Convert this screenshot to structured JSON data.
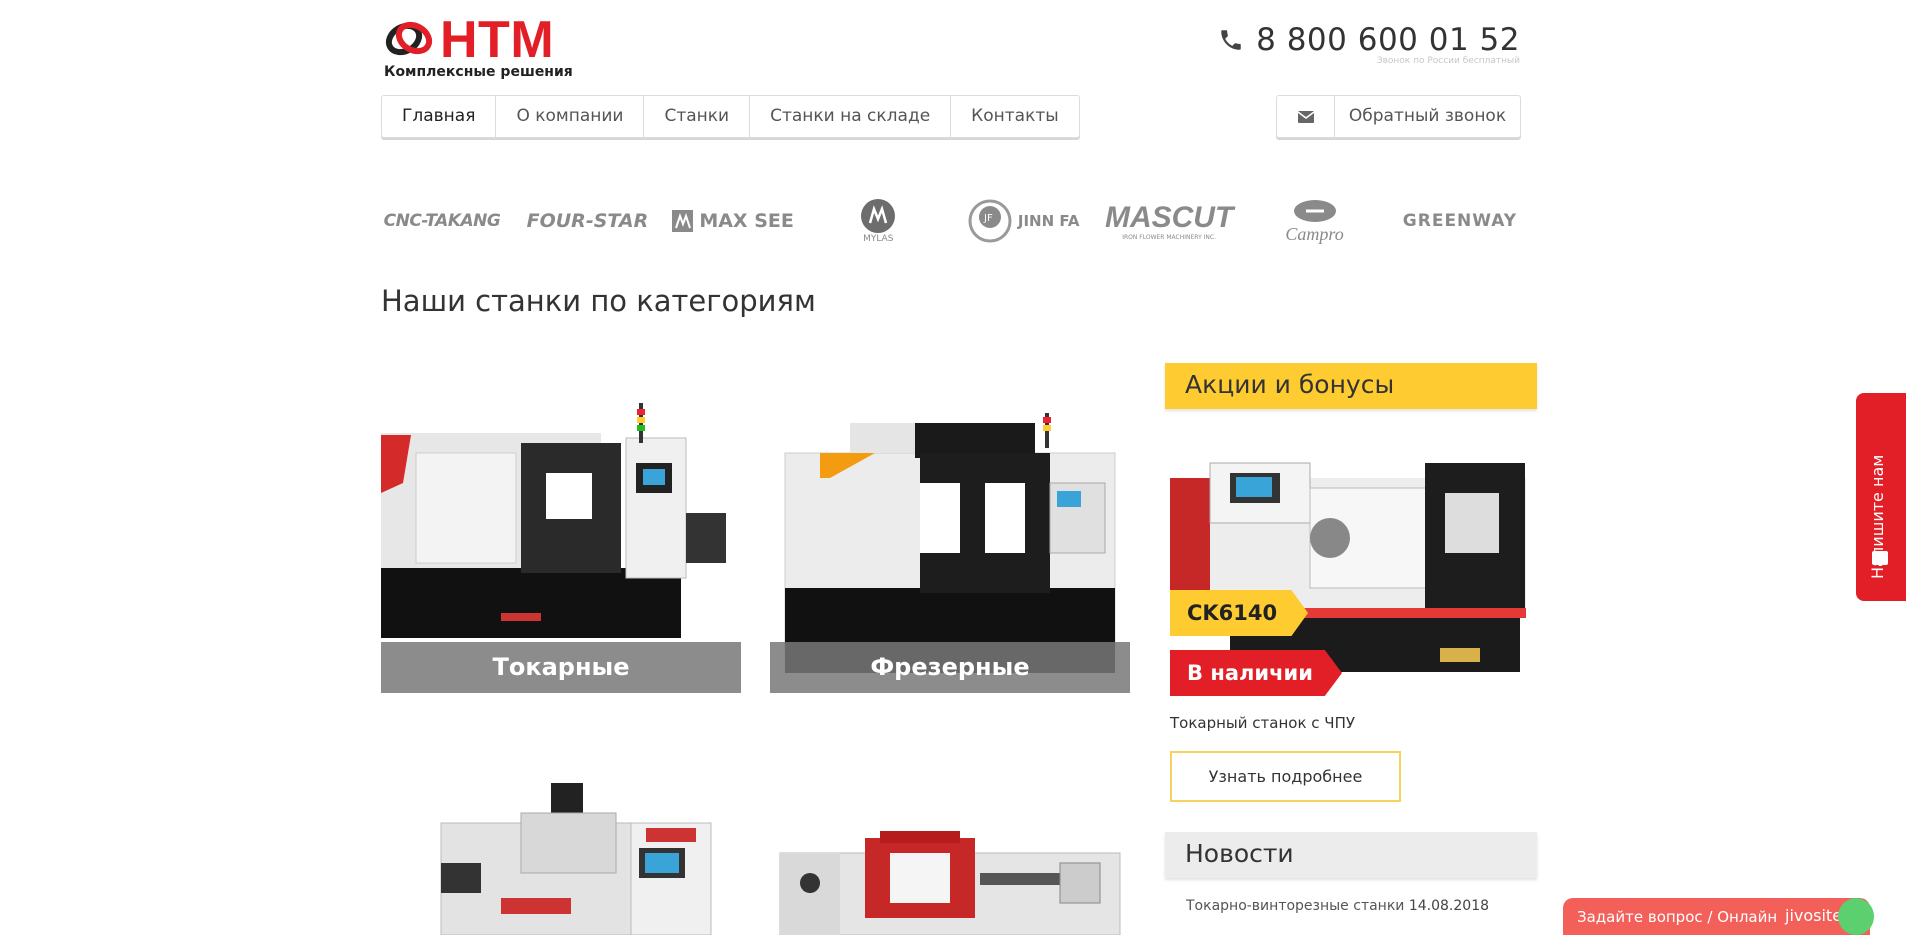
{
  "header": {
    "logo_text": "HTM",
    "logo_subtitle": "Комплексные решения",
    "phone": "8 800 600 01 52",
    "phone_note": "Звонок по России бесплатный"
  },
  "nav": {
    "items": [
      {
        "label": "Главная",
        "active": true
      },
      {
        "label": "О компании",
        "active": false
      },
      {
        "label": "Станки",
        "active": false
      },
      {
        "label": "Станки на складе",
        "active": false
      },
      {
        "label": "Контакты",
        "active": false
      }
    ],
    "callback_label": "Обратный звонок",
    "callback_icon": "envelope-icon"
  },
  "brands": [
    "CNC-TAKANG",
    "FOUR-STAR",
    "MAX SEE",
    "MYLAS",
    "JINN FA",
    "MASCUT",
    "Campro",
    "GREENWAY"
  ],
  "brand_sublabels": {
    "mylas": "MYLAS",
    "mascut": "IRON FLOWER MACHINERY INC."
  },
  "section_title": "Наши станки по категориям",
  "categories": [
    {
      "label": "Токарные"
    },
    {
      "label": "Фрезерные"
    },
    {
      "label": ""
    },
    {
      "label": ""
    }
  ],
  "sidebar": {
    "promo_title": "Акции и бонусы",
    "promo_model": "CK6140",
    "promo_stock": "В наличии",
    "promo_desc": "Токарный станок с ЧПУ",
    "promo_button": "Узнать подробнее",
    "news_title": "Новости",
    "news_item_title": "Токарно-винторезные станки",
    "news_item_date": "14.08.2018"
  },
  "side_tab": {
    "label": "Напишите нам"
  },
  "chat": {
    "label": "Задайте вопрос / Онлайн",
    "brand": "jivosite"
  },
  "colors": {
    "accent_red": "#e21f26",
    "accent_yellow": "#fecb31",
    "chat": "#f3605a"
  }
}
